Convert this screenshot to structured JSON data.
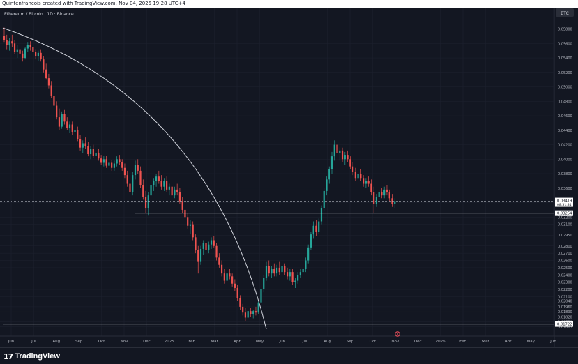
{
  "header": {
    "text": "Quintenfrancois created with TradingView.com, Nov 04, 2025 19:28 UTC+4"
  },
  "footer": {
    "logo_mark": "17",
    "logo_text": "TradingView"
  },
  "colors": {
    "background": "#131722",
    "up": "#26a69a",
    "down": "#ef5350",
    "price_line": "#b2b5be",
    "level": "#ffffff"
  },
  "chart_data": {
    "type": "candlestick",
    "title": "Ethereum / Bitcoin · 1D · Binance",
    "currency": "BTC",
    "x_ticks": [
      "Jun",
      "Jul",
      "Aug",
      "Sep",
      "Oct",
      "Nov",
      "Dec",
      "2025",
      "Feb",
      "Mar",
      "Apr",
      "May",
      "Jun",
      "Jul",
      "Aug",
      "Sep",
      "Oct",
      "Nov",
      "Dec",
      "2026",
      "Feb",
      "Mar",
      "Apr",
      "May",
      "Jun"
    ],
    "y_ticks": [
      "0.05800",
      "0.05600",
      "0.05400",
      "0.05200",
      "0.05000",
      "0.04800",
      "0.04600",
      "0.04400",
      "0.04200",
      "0.04000",
      "0.03800",
      "0.03600",
      "0.03400",
      "0.03200",
      "0.03100",
      "0.02950",
      "0.02800",
      "0.02700",
      "0.02600",
      "0.02500",
      "0.02400",
      "0.02300",
      "0.02200",
      "0.02100",
      "0.02040",
      "0.01960",
      "0.01890",
      "0.01820",
      "0.01750",
      "0.01685"
    ],
    "ylim": [
      0.0167,
      0.0595
    ],
    "last_price": "0.03419",
    "countdown": "08:31:31",
    "levels": [
      "0.03254",
      "0.01722"
    ],
    "curve_label": "",
    "ohlc": [
      {
        "t": 0,
        "o": 0.057,
        "h": 0.0582,
        "l": 0.0562,
        "c": 0.0565
      },
      {
        "t": 2,
        "o": 0.0565,
        "h": 0.0572,
        "l": 0.0552,
        "c": 0.0558
      },
      {
        "t": 4,
        "o": 0.0558,
        "h": 0.0568,
        "l": 0.055,
        "c": 0.0563
      },
      {
        "t": 6,
        "o": 0.0563,
        "h": 0.0572,
        "l": 0.0555,
        "c": 0.056
      },
      {
        "t": 8,
        "o": 0.056,
        "h": 0.0565,
        "l": 0.0545,
        "c": 0.0548
      },
      {
        "t": 10,
        "o": 0.0548,
        "h": 0.0558,
        "l": 0.054,
        "c": 0.0552
      },
      {
        "t": 12,
        "o": 0.0552,
        "h": 0.056,
        "l": 0.0544,
        "c": 0.0546
      },
      {
        "t": 14,
        "o": 0.0546,
        "h": 0.055,
        "l": 0.0535,
        "c": 0.054
      },
      {
        "t": 16,
        "o": 0.054,
        "h": 0.0555,
        "l": 0.0538,
        "c": 0.0553
      },
      {
        "t": 18,
        "o": 0.0553,
        "h": 0.0562,
        "l": 0.0548,
        "c": 0.0558
      },
      {
        "t": 20,
        "o": 0.0558,
        "h": 0.0563,
        "l": 0.055,
        "c": 0.0555
      },
      {
        "t": 22,
        "o": 0.0555,
        "h": 0.056,
        "l": 0.0545,
        "c": 0.0548
      },
      {
        "t": 24,
        "o": 0.0548,
        "h": 0.0552,
        "l": 0.0538,
        "c": 0.0542
      },
      {
        "t": 26,
        "o": 0.0542,
        "h": 0.055,
        "l": 0.0536,
        "c": 0.0547
      },
      {
        "t": 28,
        "o": 0.0547,
        "h": 0.0552,
        "l": 0.0535,
        "c": 0.0538
      },
      {
        "t": 30,
        "o": 0.0538,
        "h": 0.0542,
        "l": 0.052,
        "c": 0.0524
      },
      {
        "t": 32,
        "o": 0.0524,
        "h": 0.0532,
        "l": 0.051,
        "c": 0.0512
      },
      {
        "t": 34,
        "o": 0.0512,
        "h": 0.0518,
        "l": 0.0498,
        "c": 0.0502
      },
      {
        "t": 36,
        "o": 0.0502,
        "h": 0.0508,
        "l": 0.0485,
        "c": 0.0488
      },
      {
        "t": 38,
        "o": 0.0488,
        "h": 0.0494,
        "l": 0.047,
        "c": 0.0474
      },
      {
        "t": 40,
        "o": 0.0474,
        "h": 0.048,
        "l": 0.0455,
        "c": 0.0458
      },
      {
        "t": 42,
        "o": 0.0458,
        "h": 0.047,
        "l": 0.044,
        "c": 0.0445
      },
      {
        "t": 44,
        "o": 0.0445,
        "h": 0.0466,
        "l": 0.0442,
        "c": 0.0462
      },
      {
        "t": 46,
        "o": 0.0462,
        "h": 0.0468,
        "l": 0.0448,
        "c": 0.0452
      },
      {
        "t": 48,
        "o": 0.0452,
        "h": 0.0458,
        "l": 0.044,
        "c": 0.0443
      },
      {
        "t": 50,
        "o": 0.0443,
        "h": 0.0452,
        "l": 0.0436,
        "c": 0.0448
      },
      {
        "t": 52,
        "o": 0.0448,
        "h": 0.0452,
        "l": 0.0434,
        "c": 0.0437
      },
      {
        "t": 54,
        "o": 0.0437,
        "h": 0.0444,
        "l": 0.0428,
        "c": 0.044
      },
      {
        "t": 56,
        "o": 0.044,
        "h": 0.0445,
        "l": 0.0425,
        "c": 0.0428
      },
      {
        "t": 58,
        "o": 0.0428,
        "h": 0.0434,
        "l": 0.0412,
        "c": 0.0416
      },
      {
        "t": 60,
        "o": 0.0416,
        "h": 0.0426,
        "l": 0.0408,
        "c": 0.0422
      },
      {
        "t": 62,
        "o": 0.0422,
        "h": 0.043,
        "l": 0.0414,
        "c": 0.0418
      },
      {
        "t": 64,
        "o": 0.0418,
        "h": 0.0424,
        "l": 0.0404,
        "c": 0.0407
      },
      {
        "t": 66,
        "o": 0.0407,
        "h": 0.0418,
        "l": 0.04,
        "c": 0.0414
      },
      {
        "t": 68,
        "o": 0.0414,
        "h": 0.042,
        "l": 0.0402,
        "c": 0.0405
      },
      {
        "t": 70,
        "o": 0.0405,
        "h": 0.0412,
        "l": 0.0396,
        "c": 0.0409
      },
      {
        "t": 72,
        "o": 0.0409,
        "h": 0.0414,
        "l": 0.0398,
        "c": 0.0401
      },
      {
        "t": 74,
        "o": 0.0401,
        "h": 0.0406,
        "l": 0.0392,
        "c": 0.0395
      },
      {
        "t": 76,
        "o": 0.0395,
        "h": 0.0404,
        "l": 0.039,
        "c": 0.04
      },
      {
        "t": 78,
        "o": 0.04,
        "h": 0.0405,
        "l": 0.0388,
        "c": 0.0391
      },
      {
        "t": 80,
        "o": 0.0391,
        "h": 0.0398,
        "l": 0.0386,
        "c": 0.0395
      },
      {
        "t": 82,
        "o": 0.0395,
        "h": 0.0399,
        "l": 0.0384,
        "c": 0.0388
      },
      {
        "t": 84,
        "o": 0.0388,
        "h": 0.0398,
        "l": 0.0384,
        "c": 0.0394
      },
      {
        "t": 86,
        "o": 0.0394,
        "h": 0.0404,
        "l": 0.039,
        "c": 0.04
      },
      {
        "t": 88,
        "o": 0.04,
        "h": 0.0406,
        "l": 0.0392,
        "c": 0.0396
      },
      {
        "t": 90,
        "o": 0.0396,
        "h": 0.04,
        "l": 0.0384,
        "c": 0.0388
      },
      {
        "t": 92,
        "o": 0.0388,
        "h": 0.0394,
        "l": 0.0374,
        "c": 0.0378
      },
      {
        "t": 94,
        "o": 0.0378,
        "h": 0.0384,
        "l": 0.0362,
        "c": 0.0366
      },
      {
        "t": 96,
        "o": 0.0366,
        "h": 0.0372,
        "l": 0.035,
        "c": 0.0354
      },
      {
        "t": 98,
        "o": 0.0354,
        "h": 0.0382,
        "l": 0.035,
        "c": 0.0378
      },
      {
        "t": 100,
        "o": 0.0378,
        "h": 0.0398,
        "l": 0.0372,
        "c": 0.0392
      },
      {
        "t": 102,
        "o": 0.0392,
        "h": 0.04,
        "l": 0.038,
        "c": 0.0384
      },
      {
        "t": 104,
        "o": 0.0384,
        "h": 0.039,
        "l": 0.036,
        "c": 0.0364
      },
      {
        "t": 106,
        "o": 0.0364,
        "h": 0.0372,
        "l": 0.0344,
        "c": 0.0348
      },
      {
        "t": 108,
        "o": 0.0348,
        "h": 0.0356,
        "l": 0.0326,
        "c": 0.0332
      },
      {
        "t": 110,
        "o": 0.0332,
        "h": 0.0354,
        "l": 0.0322,
        "c": 0.035
      },
      {
        "t": 112,
        "o": 0.035,
        "h": 0.0368,
        "l": 0.0344,
        "c": 0.0364
      },
      {
        "t": 114,
        "o": 0.0364,
        "h": 0.0374,
        "l": 0.0356,
        "c": 0.037
      },
      {
        "t": 116,
        "o": 0.037,
        "h": 0.038,
        "l": 0.0362,
        "c": 0.0376
      },
      {
        "t": 118,
        "o": 0.0376,
        "h": 0.0384,
        "l": 0.0366,
        "c": 0.037
      },
      {
        "t": 120,
        "o": 0.037,
        "h": 0.0378,
        "l": 0.0358,
        "c": 0.0362
      },
      {
        "t": 122,
        "o": 0.0362,
        "h": 0.0374,
        "l": 0.0356,
        "c": 0.037
      },
      {
        "t": 124,
        "o": 0.037,
        "h": 0.0376,
        "l": 0.0354,
        "c": 0.0358
      },
      {
        "t": 126,
        "o": 0.0358,
        "h": 0.0366,
        "l": 0.035,
        "c": 0.0362
      },
      {
        "t": 128,
        "o": 0.0362,
        "h": 0.0368,
        "l": 0.0346,
        "c": 0.035
      },
      {
        "t": 130,
        "o": 0.035,
        "h": 0.0362,
        "l": 0.0346,
        "c": 0.0358
      },
      {
        "t": 132,
        "o": 0.0358,
        "h": 0.0366,
        "l": 0.035,
        "c": 0.0354
      },
      {
        "t": 134,
        "o": 0.0354,
        "h": 0.036,
        "l": 0.0338,
        "c": 0.0342
      },
      {
        "t": 136,
        "o": 0.0342,
        "h": 0.0348,
        "l": 0.0326,
        "c": 0.033
      },
      {
        "t": 138,
        "o": 0.033,
        "h": 0.0336,
        "l": 0.0316,
        "c": 0.032
      },
      {
        "t": 140,
        "o": 0.032,
        "h": 0.0326,
        "l": 0.0304,
        "c": 0.0308
      },
      {
        "t": 142,
        "o": 0.0308,
        "h": 0.0316,
        "l": 0.0296,
        "c": 0.031
      },
      {
        "t": 144,
        "o": 0.031,
        "h": 0.0314,
        "l": 0.0288,
        "c": 0.0292
      },
      {
        "t": 146,
        "o": 0.0292,
        "h": 0.0296,
        "l": 0.027,
        "c": 0.0274
      },
      {
        "t": 148,
        "o": 0.0274,
        "h": 0.028,
        "l": 0.0242,
        "c": 0.0258
      },
      {
        "t": 150,
        "o": 0.0258,
        "h": 0.028,
        "l": 0.0254,
        "c": 0.0276
      },
      {
        "t": 152,
        "o": 0.0276,
        "h": 0.0288,
        "l": 0.0268,
        "c": 0.0284
      },
      {
        "t": 154,
        "o": 0.0284,
        "h": 0.029,
        "l": 0.027,
        "c": 0.0274
      },
      {
        "t": 156,
        "o": 0.0274,
        "h": 0.0286,
        "l": 0.027,
        "c": 0.0282
      },
      {
        "t": 158,
        "o": 0.0282,
        "h": 0.0292,
        "l": 0.0276,
        "c": 0.0288
      },
      {
        "t": 160,
        "o": 0.0288,
        "h": 0.0294,
        "l": 0.0278,
        "c": 0.028
      },
      {
        "t": 162,
        "o": 0.028,
        "h": 0.0284,
        "l": 0.026,
        "c": 0.0264
      },
      {
        "t": 164,
        "o": 0.0264,
        "h": 0.027,
        "l": 0.025,
        "c": 0.0254
      },
      {
        "t": 166,
        "o": 0.0254,
        "h": 0.026,
        "l": 0.0238,
        "c": 0.0242
      },
      {
        "t": 168,
        "o": 0.0242,
        "h": 0.0248,
        "l": 0.0228,
        "c": 0.0232
      },
      {
        "t": 170,
        "o": 0.0232,
        "h": 0.0246,
        "l": 0.0228,
        "c": 0.0242
      },
      {
        "t": 172,
        "o": 0.0242,
        "h": 0.0248,
        "l": 0.0234,
        "c": 0.0238
      },
      {
        "t": 174,
        "o": 0.0238,
        "h": 0.0242,
        "l": 0.0224,
        "c": 0.0228
      },
      {
        "t": 176,
        "o": 0.0228,
        "h": 0.0234,
        "l": 0.0218,
        "c": 0.0222
      },
      {
        "t": 178,
        "o": 0.0222,
        "h": 0.0226,
        "l": 0.0204,
        "c": 0.0208
      },
      {
        "t": 180,
        "o": 0.0208,
        "h": 0.0212,
        "l": 0.0192,
        "c": 0.0196
      },
      {
        "t": 182,
        "o": 0.0196,
        "h": 0.02,
        "l": 0.0184,
        "c": 0.0188
      },
      {
        "t": 184,
        "o": 0.0188,
        "h": 0.0194,
        "l": 0.0176,
        "c": 0.0181
      },
      {
        "t": 186,
        "o": 0.0181,
        "h": 0.0192,
        "l": 0.0178,
        "c": 0.019
      },
      {
        "t": 188,
        "o": 0.019,
        "h": 0.0194,
        "l": 0.0182,
        "c": 0.0186
      },
      {
        "t": 190,
        "o": 0.0186,
        "h": 0.0192,
        "l": 0.018,
        "c": 0.019
      },
      {
        "t": 192,
        "o": 0.019,
        "h": 0.0196,
        "l": 0.0184,
        "c": 0.0188
      },
      {
        "t": 194,
        "o": 0.0188,
        "h": 0.0204,
        "l": 0.0186,
        "c": 0.0202
      },
      {
        "t": 196,
        "o": 0.0202,
        "h": 0.0224,
        "l": 0.02,
        "c": 0.022
      },
      {
        "t": 198,
        "o": 0.022,
        "h": 0.024,
        "l": 0.0216,
        "c": 0.0236
      },
      {
        "t": 200,
        "o": 0.0236,
        "h": 0.0258,
        "l": 0.0232,
        "c": 0.0252
      },
      {
        "t": 202,
        "o": 0.0252,
        "h": 0.026,
        "l": 0.0238,
        "c": 0.0242
      },
      {
        "t": 204,
        "o": 0.0242,
        "h": 0.0252,
        "l": 0.0236,
        "c": 0.0248
      },
      {
        "t": 206,
        "o": 0.0248,
        "h": 0.0256,
        "l": 0.0238,
        "c": 0.0242
      },
      {
        "t": 208,
        "o": 0.0242,
        "h": 0.0254,
        "l": 0.0238,
        "c": 0.025
      },
      {
        "t": 210,
        "o": 0.025,
        "h": 0.0258,
        "l": 0.024,
        "c": 0.0244
      },
      {
        "t": 212,
        "o": 0.0244,
        "h": 0.0256,
        "l": 0.024,
        "c": 0.0252
      },
      {
        "t": 214,
        "o": 0.0252,
        "h": 0.0256,
        "l": 0.024,
        "c": 0.0244
      },
      {
        "t": 216,
        "o": 0.0244,
        "h": 0.025,
        "l": 0.0234,
        "c": 0.0238
      },
      {
        "t": 218,
        "o": 0.0238,
        "h": 0.0248,
        "l": 0.0232,
        "c": 0.0244
      },
      {
        "t": 220,
        "o": 0.0244,
        "h": 0.0248,
        "l": 0.0226,
        "c": 0.023
      },
      {
        "t": 222,
        "o": 0.023,
        "h": 0.0236,
        "l": 0.0222,
        "c": 0.0232
      },
      {
        "t": 224,
        "o": 0.0232,
        "h": 0.0244,
        "l": 0.0228,
        "c": 0.024
      },
      {
        "t": 226,
        "o": 0.024,
        "h": 0.0248,
        "l": 0.0236,
        "c": 0.0244
      },
      {
        "t": 228,
        "o": 0.0244,
        "h": 0.0252,
        "l": 0.0238,
        "c": 0.0248
      },
      {
        "t": 230,
        "o": 0.0248,
        "h": 0.0264,
        "l": 0.0244,
        "c": 0.026
      },
      {
        "t": 232,
        "o": 0.026,
        "h": 0.0282,
        "l": 0.0256,
        "c": 0.0278
      },
      {
        "t": 234,
        "o": 0.0278,
        "h": 0.03,
        "l": 0.0274,
        "c": 0.0296
      },
      {
        "t": 236,
        "o": 0.0296,
        "h": 0.0314,
        "l": 0.029,
        "c": 0.0308
      },
      {
        "t": 238,
        "o": 0.0308,
        "h": 0.0316,
        "l": 0.0294,
        "c": 0.03
      },
      {
        "t": 240,
        "o": 0.03,
        "h": 0.0318,
        "l": 0.0296,
        "c": 0.0314
      },
      {
        "t": 242,
        "o": 0.0314,
        "h": 0.0336,
        "l": 0.031,
        "c": 0.0332
      },
      {
        "t": 244,
        "o": 0.0332,
        "h": 0.036,
        "l": 0.0328,
        "c": 0.0356
      },
      {
        "t": 246,
        "o": 0.0356,
        "h": 0.0376,
        "l": 0.035,
        "c": 0.0372
      },
      {
        "t": 248,
        "o": 0.0372,
        "h": 0.039,
        "l": 0.0366,
        "c": 0.0386
      },
      {
        "t": 250,
        "o": 0.0386,
        "h": 0.041,
        "l": 0.038,
        "c": 0.0404
      },
      {
        "t": 252,
        "o": 0.0404,
        "h": 0.0426,
        "l": 0.0398,
        "c": 0.042
      },
      {
        "t": 254,
        "o": 0.042,
        "h": 0.0428,
        "l": 0.0404,
        "c": 0.0408
      },
      {
        "t": 256,
        "o": 0.0408,
        "h": 0.0416,
        "l": 0.0398,
        "c": 0.0412
      },
      {
        "t": 258,
        "o": 0.0412,
        "h": 0.0416,
        "l": 0.0396,
        "c": 0.04
      },
      {
        "t": 260,
        "o": 0.04,
        "h": 0.041,
        "l": 0.0392,
        "c": 0.0406
      },
      {
        "t": 262,
        "o": 0.0406,
        "h": 0.0412,
        "l": 0.0396,
        "c": 0.04
      },
      {
        "t": 264,
        "o": 0.04,
        "h": 0.0404,
        "l": 0.0386,
        "c": 0.039
      },
      {
        "t": 266,
        "o": 0.039,
        "h": 0.0396,
        "l": 0.0378,
        "c": 0.0382
      },
      {
        "t": 268,
        "o": 0.0382,
        "h": 0.0388,
        "l": 0.037,
        "c": 0.0374
      },
      {
        "t": 270,
        "o": 0.0374,
        "h": 0.0384,
        "l": 0.0368,
        "c": 0.038
      },
      {
        "t": 272,
        "o": 0.038,
        "h": 0.0386,
        "l": 0.037,
        "c": 0.0374
      },
      {
        "t": 274,
        "o": 0.0374,
        "h": 0.0378,
        "l": 0.0362,
        "c": 0.0366
      },
      {
        "t": 276,
        "o": 0.0366,
        "h": 0.0374,
        "l": 0.036,
        "c": 0.037
      },
      {
        "t": 278,
        "o": 0.037,
        "h": 0.0376,
        "l": 0.0362,
        "c": 0.0366
      },
      {
        "t": 280,
        "o": 0.0366,
        "h": 0.0372,
        "l": 0.035,
        "c": 0.0354
      },
      {
        "t": 282,
        "o": 0.0354,
        "h": 0.0362,
        "l": 0.0326,
        "c": 0.0338
      },
      {
        "t": 284,
        "o": 0.0338,
        "h": 0.0352,
        "l": 0.0334,
        "c": 0.0348
      },
      {
        "t": 286,
        "o": 0.0348,
        "h": 0.0358,
        "l": 0.0344,
        "c": 0.0354
      },
      {
        "t": 288,
        "o": 0.0354,
        "h": 0.036,
        "l": 0.0346,
        "c": 0.035
      },
      {
        "t": 290,
        "o": 0.035,
        "h": 0.0362,
        "l": 0.0346,
        "c": 0.0358
      },
      {
        "t": 292,
        "o": 0.0358,
        "h": 0.0364,
        "l": 0.035,
        "c": 0.0354
      },
      {
        "t": 294,
        "o": 0.0354,
        "h": 0.0358,
        "l": 0.0342,
        "c": 0.0346
      },
      {
        "t": 296,
        "o": 0.0346,
        "h": 0.0352,
        "l": 0.0334,
        "c": 0.0338
      },
      {
        "t": 298,
        "o": 0.0338,
        "h": 0.0346,
        "l": 0.0332,
        "c": 0.0342
      }
    ]
  }
}
